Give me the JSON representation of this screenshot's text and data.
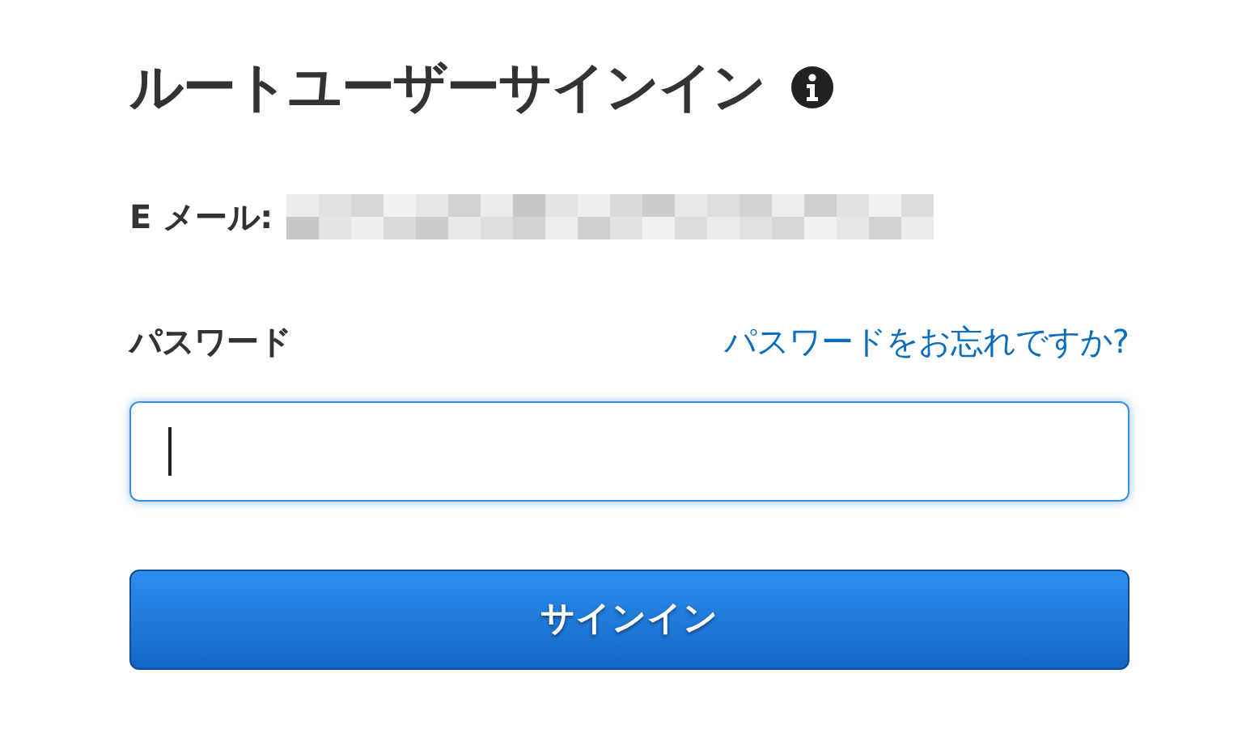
{
  "title": "ルートユーザーサインイン",
  "email": {
    "label": "E メール:",
    "value_redacted": true
  },
  "password": {
    "label": "パスワード",
    "forgot_link": "パスワードをお忘れですか?",
    "focused": true
  },
  "submit_button": "サインイン"
}
